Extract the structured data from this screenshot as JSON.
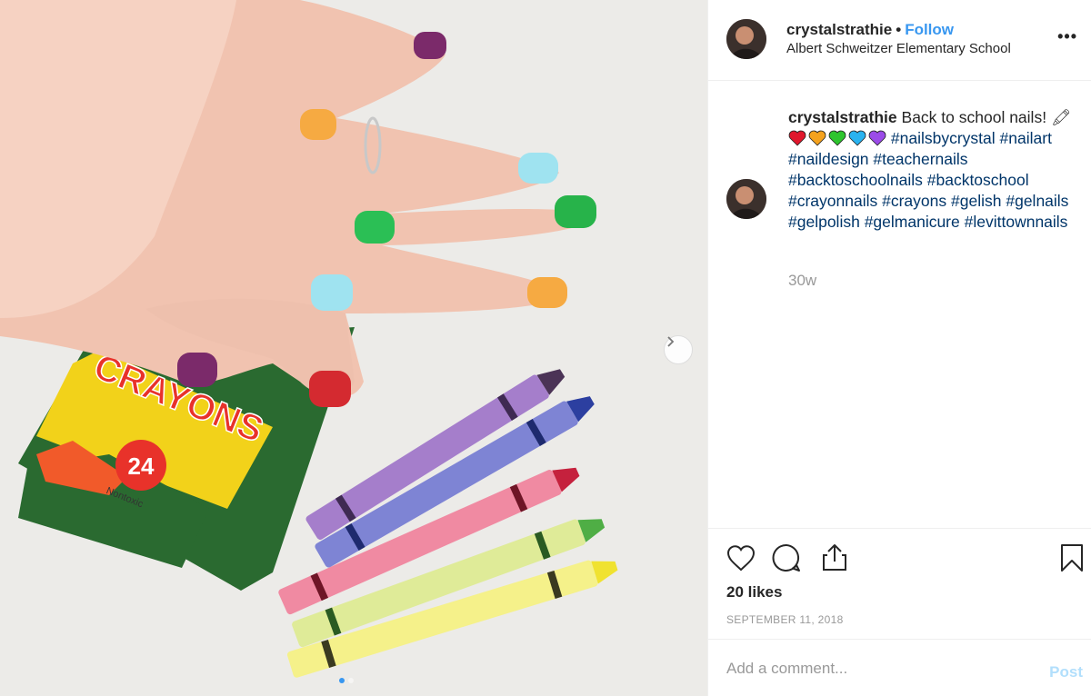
{
  "post": {
    "username": "crystalstrathie",
    "separator": "•",
    "follow_label": "Follow",
    "location": "Albert Schweitzer Elementary School",
    "more_label": "•••"
  },
  "caption": {
    "username": "crystalstrathie",
    "text": "Back to school nails!",
    "pencil_emoji": "🖍",
    "hearts": [
      "❤️",
      "🧡",
      "💚",
      "💙",
      "💜"
    ],
    "heart_colors": [
      "#e0182d",
      "#f4a21e",
      "#2ec52e",
      "#29b3f0",
      "#9b4be8"
    ],
    "hashtags": [
      "#nailsbycrystal",
      "#nailart",
      "#naildesign",
      "#teachernails",
      "#backtoschoolnails",
      "#backtoschool",
      "#crayonnails",
      "#crayons",
      "#gelish",
      "#gelnails",
      "#gelpolish",
      "#gelmanicure",
      "#levittownnails"
    ]
  },
  "time_ago": "30w",
  "likes": "20 likes",
  "date": "SEPTEMBER 11, 2018",
  "comment": {
    "placeholder": "Add a comment...",
    "post_label": "Post"
  },
  "photo": {
    "box_brand": "CRAYONS",
    "box_count": "24",
    "box_subtext": "Nontoxic",
    "crayon_labels": [
      "violet",
      "blue violet",
      "violet red",
      "yellow green",
      "yellow"
    ]
  },
  "icons": [
    "heart-icon",
    "comment-icon",
    "share-icon",
    "bookmark-icon",
    "chevron-right-icon"
  ],
  "colors": {
    "accent": "#3897f0",
    "hashtag": "#003569",
    "muted": "#999999",
    "post_disabled": "#b2dffc"
  }
}
